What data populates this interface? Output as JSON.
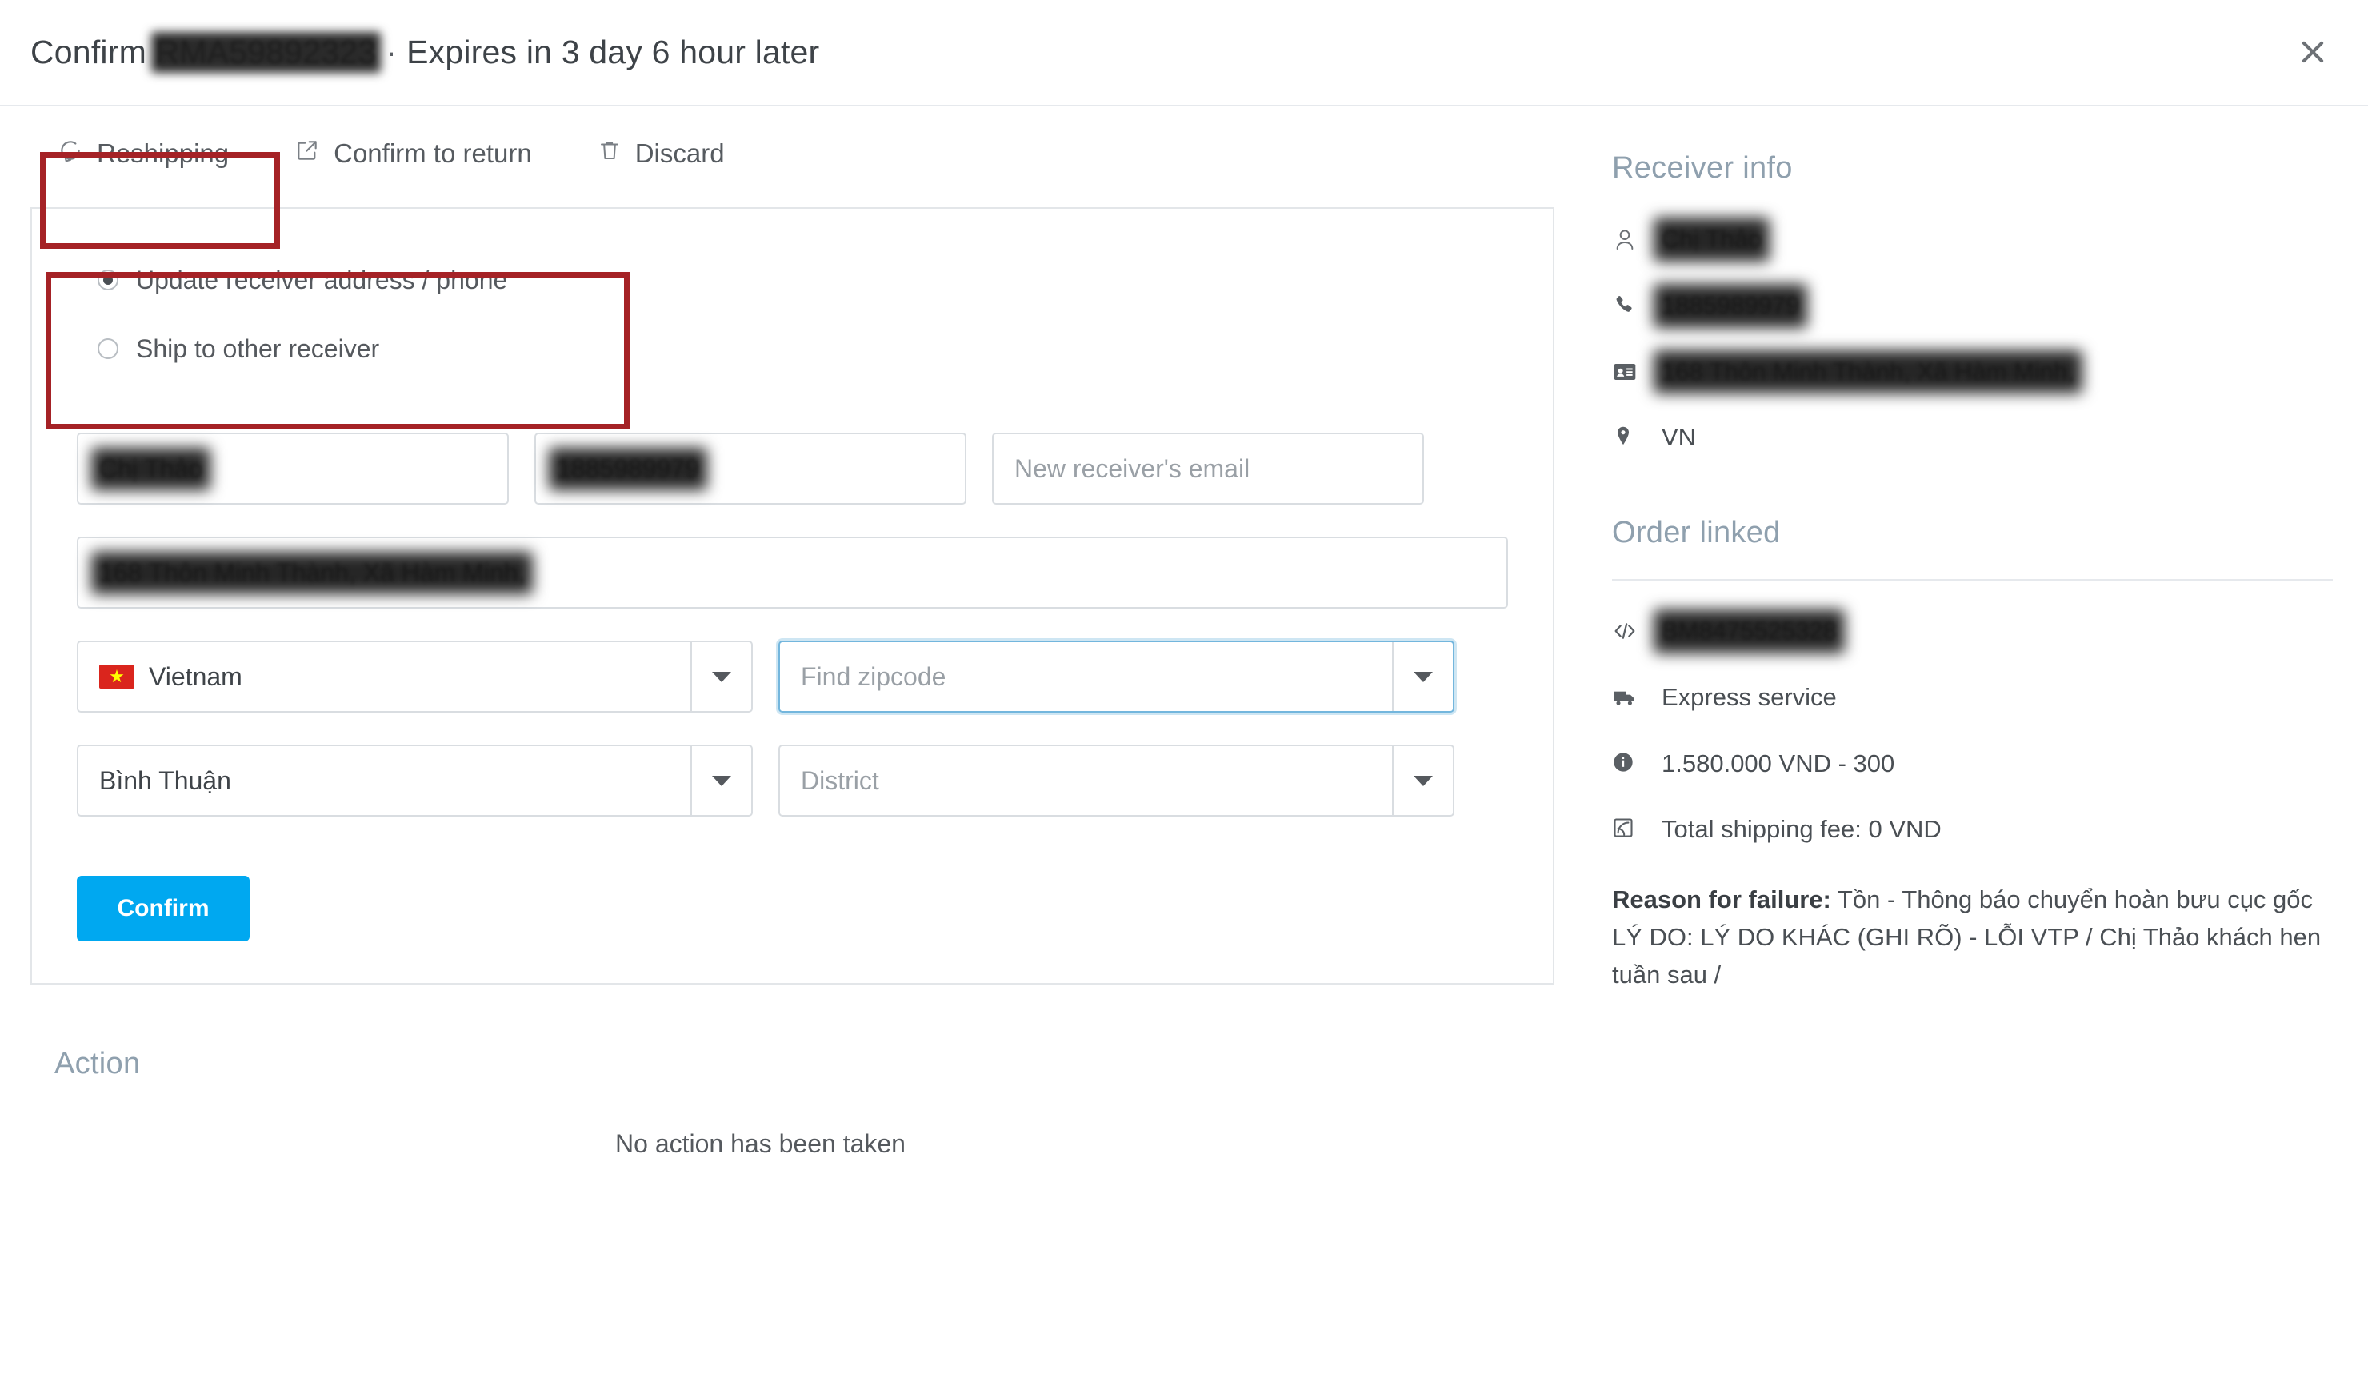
{
  "header": {
    "title_prefix": "Confirm",
    "rma_code": "RMA59892323",
    "separator": "·",
    "expiry_text": "Expires in 3 day 6 hour later",
    "close_icon": "close-icon"
  },
  "toolbar": {
    "items": [
      {
        "label": "Reshipping",
        "icon": "reshipping-icon",
        "active": true
      },
      {
        "label": "Confirm to return",
        "icon": "external-link-icon",
        "active": false
      },
      {
        "label": "Discard",
        "icon": "trash-icon",
        "active": false
      }
    ]
  },
  "form": {
    "radio_options": [
      {
        "label": "Update receiver address / phone",
        "selected": true
      },
      {
        "label": "Ship to other receiver",
        "selected": false
      }
    ],
    "receiver_name": {
      "value": "Chị Thảo",
      "redacted": true
    },
    "receiver_phone": {
      "value": "1885989979",
      "redacted": true
    },
    "receiver_email": {
      "placeholder": "New receiver's email",
      "value": ""
    },
    "address": {
      "value": "168 Thôn Minh Thành, Xã Hàm Minh,",
      "redacted": true
    },
    "country": {
      "value": "Vietnam",
      "flag": "vn-flag-icon"
    },
    "zipcode": {
      "placeholder": "Find zipcode",
      "value": "",
      "focused": true
    },
    "province": {
      "value": "Bình Thuận"
    },
    "district": {
      "placeholder": "District",
      "value": ""
    },
    "confirm_label": "Confirm"
  },
  "action": {
    "title": "Action",
    "empty_text": "No action has been taken"
  },
  "receiver_info": {
    "title": "Receiver info",
    "name": {
      "value": "Chị Thảo",
      "icon": "user-icon",
      "redacted": true
    },
    "phone": {
      "value": "1885989979",
      "icon": "phone-icon",
      "redacted": true
    },
    "address": {
      "value": "168 Thôn Minh Thành, Xã Hàm Minh,",
      "icon": "address-card-icon",
      "redacted": true
    },
    "country_code": {
      "value": "VN",
      "icon": "map-pin-icon"
    }
  },
  "order_linked": {
    "title": "Order linked",
    "order_code": {
      "value": "BM8475525328",
      "icon": "code-icon",
      "redacted": true
    },
    "service": {
      "value": "Express service",
      "icon": "truck-icon"
    },
    "amount": {
      "value": "1.580.000 VND - 300",
      "icon": "info-icon"
    },
    "shipping_fee": {
      "value": "Total shipping fee: 0 VND",
      "icon": "rss-icon"
    },
    "failure_label": "Reason for failure:",
    "failure_reason": " Tồn - Thông báo chuyển hoàn bưu cục gốc LÝ DO: LÝ DO KHÁC (GHI RÕ) - LỖI VTP / Chị Thảo khách hen tuần sau /"
  },
  "colors": {
    "annotation_red": "#a52226",
    "primary_blue": "#00a8f0",
    "heading_blue_gray": "#8fa0ae",
    "order_code_red": "#e24a27",
    "focus_blue": "#73b6dd"
  }
}
